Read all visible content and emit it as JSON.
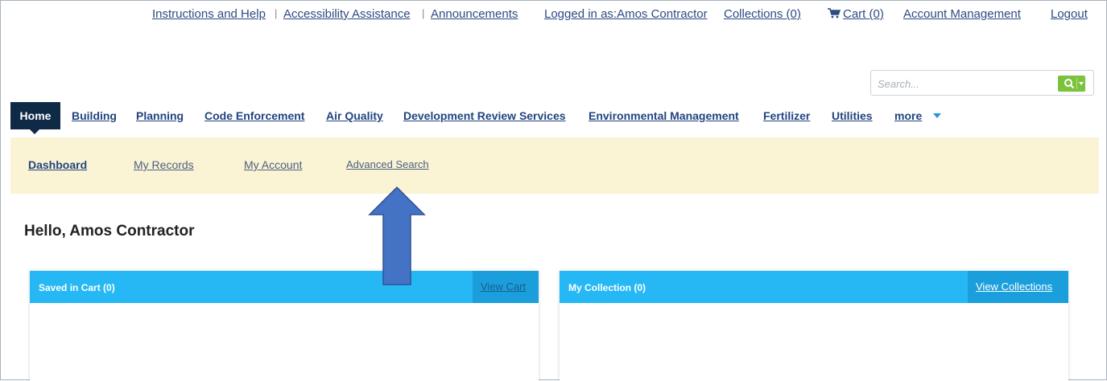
{
  "top_links": {
    "instructions": "Instructions and Help",
    "accessibility": "Accessibility Assistance",
    "announcements": "Announcements",
    "logged_in": "Logged in as:Amos Contractor",
    "collections": "Collections (0)",
    "cart": "Cart (0)",
    "account_management": "Account Management",
    "logout": "Logout",
    "separator": "|"
  },
  "search": {
    "placeholder": "Search..."
  },
  "nav": {
    "items": [
      "Home",
      "Building",
      "Planning",
      "Code Enforcement",
      "Air Quality",
      "Development Review Services",
      "Environmental Management",
      "Fertilizer",
      "Utilities",
      "more"
    ],
    "active": "Home"
  },
  "subnav": {
    "items": [
      "Dashboard",
      "My Records",
      "My Account",
      "Advanced Search"
    ],
    "active": "Dashboard"
  },
  "greeting": "Hello, Amos Contractor",
  "panels": {
    "cart": {
      "title": "Saved in Cart (0)",
      "button": "View Cart"
    },
    "collection": {
      "title": "My Collection (0)",
      "button": "View Collections"
    }
  },
  "colors": {
    "nav_active_bg": "#0f2a47",
    "subnav_bg": "#fbf4d4",
    "panel_header": "#26b8f5",
    "search_button": "#7cc33d",
    "annotation_arrow": "#4472c4"
  }
}
